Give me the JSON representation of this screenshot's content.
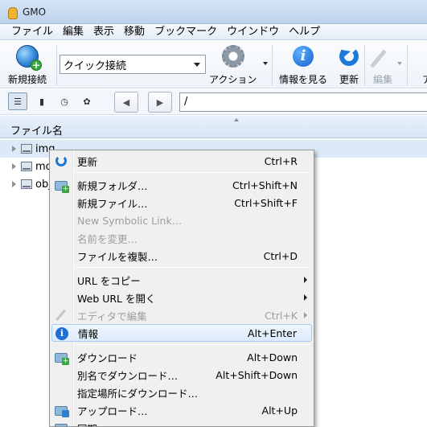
{
  "window": {
    "title": "GMO"
  },
  "menubar": {
    "items": [
      "ファイル",
      "編集",
      "表示",
      "移動",
      "ブックマーク",
      "ウインドウ",
      "ヘルプ"
    ]
  },
  "toolbar": {
    "new_connection_label": "新規接続",
    "quick_connect_value": "クイック接続",
    "action_label": "アクション",
    "info_label": "情報を見る",
    "refresh_label": "更新",
    "edit_label": "編集",
    "overflow_label": "ア"
  },
  "nav": {
    "path_value": "/",
    "back_glyph": "◀",
    "forward_glyph": "▶"
  },
  "filelist": {
    "column_name": "ファイル名",
    "rows": [
      {
        "name": "img"
      },
      {
        "name": "mo"
      },
      {
        "name": "obj"
      }
    ]
  },
  "context_menu": {
    "items": [
      {
        "label": "更新",
        "accel": "Ctrl+R",
        "icon": "refresh-icon"
      },
      {
        "label": "新規フォルダ…",
        "accel": "Ctrl+Shift+N",
        "icon": "new-folder-icon"
      },
      {
        "label": "新規ファイル…",
        "accel": "Ctrl+Shift+F"
      },
      {
        "label": "New Symbolic Link…",
        "accel": ""
      },
      {
        "label": "名前を変更…",
        "accel": ""
      },
      {
        "label": "ファイルを複製…",
        "accel": "Ctrl+D"
      },
      {
        "label": "URL をコピー",
        "accel": ""
      },
      {
        "label": "Web URL を開く",
        "accel": ""
      },
      {
        "label": "エディタで編集",
        "accel": "Ctrl+K",
        "icon": "pencil-icon"
      },
      {
        "label": "情報",
        "accel": "Alt+Enter",
        "icon": "info-icon"
      },
      {
        "label": "ダウンロード",
        "accel": "Alt+Down",
        "icon": "download-icon"
      },
      {
        "label": "別名でダウンロード…",
        "accel": "Alt+Shift+Down"
      },
      {
        "label": "指定場所にダウンロード…",
        "accel": ""
      },
      {
        "label": "アップロード…",
        "accel": "Alt+Up",
        "icon": "upload-icon"
      },
      {
        "label": "同期…",
        "accel": ""
      }
    ]
  },
  "colors": {
    "accent_blue": "#1e6fd6",
    "highlight_border": "#a8cbf1",
    "disabled_text": "#9d9d9d"
  }
}
